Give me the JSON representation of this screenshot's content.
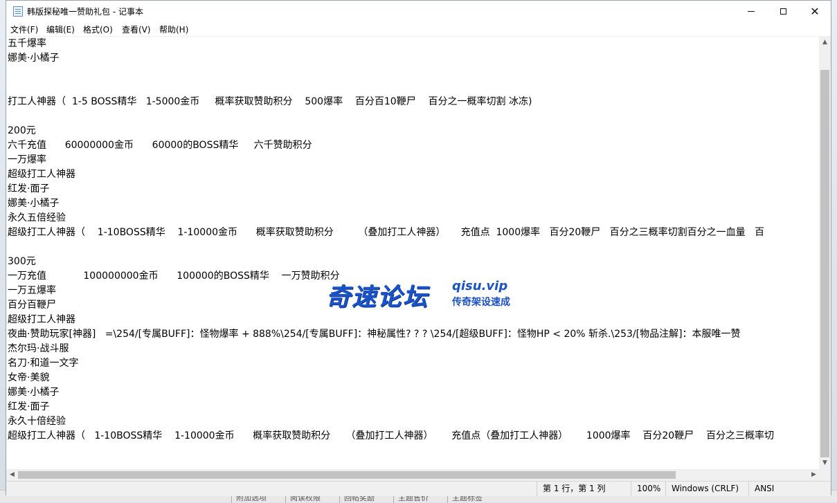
{
  "window": {
    "title": "韩版探秘唯一赞助礼包 - 记事本",
    "min_label": "",
    "close_label": "✕"
  },
  "menu": {
    "file": "文件(F)",
    "edit": "编辑(E)",
    "format": "格式(O)",
    "view": "查看(V)",
    "help": "帮助(H)"
  },
  "lines": [
    "五千爆率",
    "娜美·小橘子",
    "",
    "",
    "打工人神器（  1-5 BOSS精华   1-5000金币     概率获取赞助积分    500爆率    百分百10鞭尸    百分之一概率切割 冰冻)",
    "",
    "200元",
    "六千充值      60000000金币      60000的BOSS精华     六千赞助积分",
    "一万爆率",
    "超级打工人神器",
    "红发·面子",
    "娜美·小橘子",
    "永久五倍经验",
    "超级打工人神器（    1-10BOSS精华    1-10000金币      概率获取赞助积分        （叠加打工人神器）     充值点  1000爆率   百分20鞭尸   百分之三概率切割百分之一血量   百",
    "",
    "300元",
    "一万充值            100000000金币      100000的BOSS精华    一万赞助积分",
    "一万五爆率",
    "百分百鞭尸",
    "超级打工人神器",
    "夜曲·赞助玩家[神器]   =\\254/[专属BUFF]：怪物爆率 + 888%\\254/[专属BUFF]：神秘属性? ? ? \\254/[超级BUFF]：怪物HP < 20% 斩杀.\\253/[物品注解]：本服唯一赞",
    "杰尔玛·战斗服",
    "名刀·和道一文字",
    "女帝·美貌",
    "娜美·小橘子",
    "红发·面子",
    "永久十倍经验",
    "超级打工人神器（   1-10BOSS精华    1-10000金币      概率获取赞助积分     （叠加打工人神器）      充值点（叠加打工人神器）      1000爆率    百分20鞭尸    百分之三概率切"
  ],
  "status": {
    "position": "第 1 行，第 1 列",
    "zoom": "100%",
    "line_ending": "Windows (CRLF)",
    "encoding": "ANSI"
  },
  "watermark": {
    "main": "奇速论坛",
    "url": "qisu.vip",
    "sub": "传奇架设速成"
  },
  "background_tabs": [
    "附加选项",
    "阅读权限",
    "回帖奖励",
    "主题售价",
    "主题标签"
  ]
}
